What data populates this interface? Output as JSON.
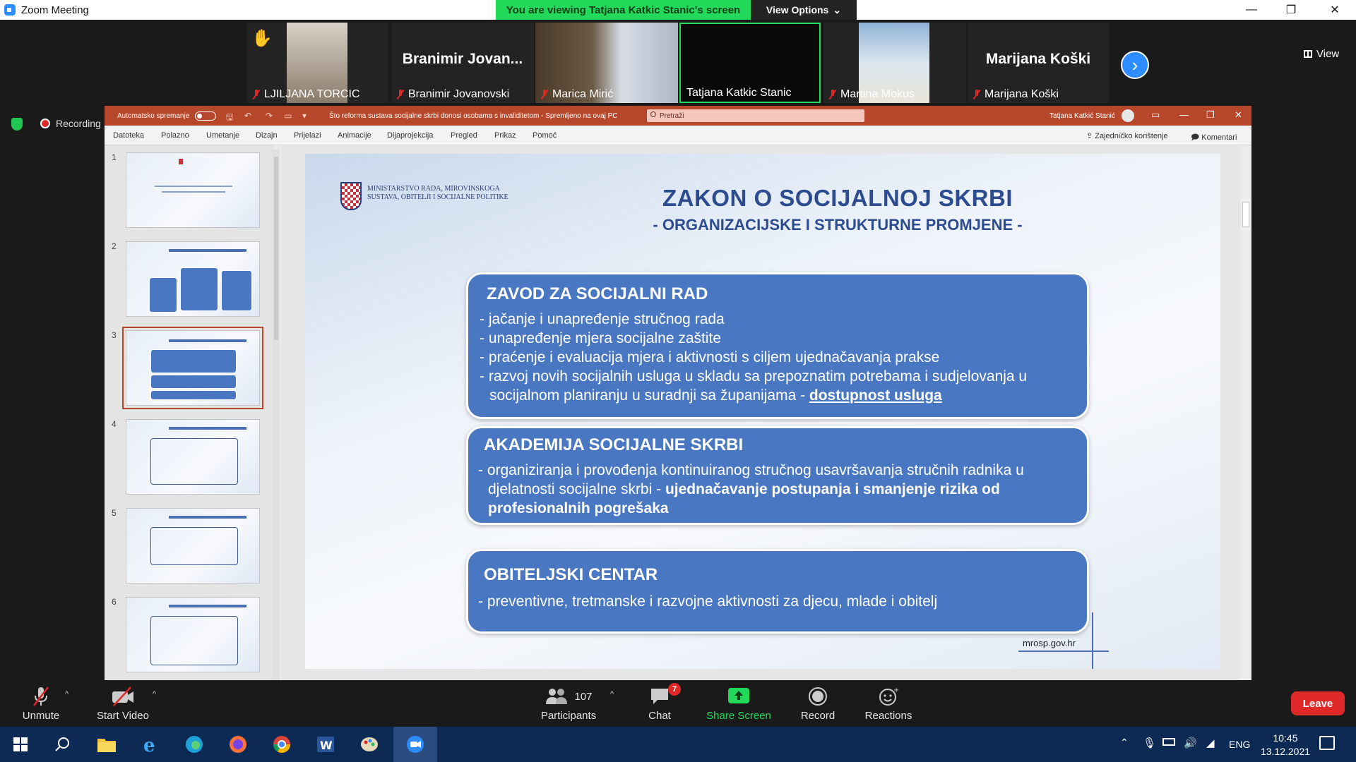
{
  "zoom": {
    "window_title": "Zoom Meeting",
    "viewing_banner": "You are viewing Tatjana Katkic Stanic's screen",
    "view_options": "View Options",
    "view_label": "View",
    "recording_label": "Recording"
  },
  "participants": [
    {
      "name": "LJILJANA TORCIC",
      "muted": true,
      "hand_raised": true
    },
    {
      "name": "Branimir Jovanovski",
      "display": "Branimir  Jovan...",
      "muted": true
    },
    {
      "name": "Marica Mirić",
      "muted": true
    },
    {
      "name": "Tatjana Katkic Stanic",
      "muted": false,
      "active_speaker": true
    },
    {
      "name": "Martina Mokus",
      "muted": true
    },
    {
      "name": "Marijana Koški",
      "display": "Marijana Koški",
      "muted": true
    }
  ],
  "ppt": {
    "autosave_label": "Automatsko spremanje",
    "doc_title": "Što reforma sustava socijalne skrbi donosi osobama s invaliditetom - Spremljeno na ovaj PC",
    "search_placeholder": "Pretraži",
    "user_name": "Tatjana Katkić Stanić",
    "tabs": [
      "Datoteka",
      "Polazno",
      "Umetanje",
      "Dizajn",
      "Prijelazi",
      "Animacije",
      "Dijaprojekcija",
      "Pregled",
      "Prikaz",
      "Pomoć"
    ],
    "share_label": "Zajedničko korištenje",
    "comments_label": "Komentari",
    "thumbnails": [
      "1",
      "2",
      "3",
      "4",
      "5",
      "6"
    ],
    "selected_slide": 3
  },
  "slide": {
    "ministry": [
      "MINISTARSTVO RADA, MIROVINSKOGA",
      "SUSTAVA, OBITELJI I SOCIJALNE POLITIKE"
    ],
    "title": "ZAKON O SOCIJALNOJ SKRBI",
    "subtitle": "- ORGANIZACIJSKE I STRUKTURNE PROMJENE -",
    "box1": {
      "header": "ZAVOD ZA SOCIJALNI RAD",
      "items": [
        "- jačanje i unapređenje stručnog rada",
        "- unapređenje mjera socijalne zaštite",
        "- praćenje i evaluacija mjera i aktivnosti  s ciljem ujednačavanja prakse",
        "- razvoj novih socijalnih usluga u skladu sa prepoznatim potrebama i sudjelovanja u"
      ],
      "item5_text": "socijalnom planiranju u suradnji sa županijama - ",
      "item5_emph": "dostupnost usluga"
    },
    "box2": {
      "header": "AKADEMIJA SOCIJALNE SKRBI",
      "line1": "- organiziranja i provođenja kontinuiranog stručnog usavršavanja stručnih radnika u",
      "line2_text": "djelatnosti socijalne skrbi - ",
      "line2_emph": "ujednačavanje postupanja i smanjenje rizika od",
      "line3_emph": "profesionalnih pogrešaka"
    },
    "box3": {
      "header": "OBITELJSKI CENTAR",
      "item": "- preventivne, tretmanske i razvojne aktivnosti za djecu, mlade i obitelj"
    },
    "url": "mrosp.gov.hr"
  },
  "toolbar": {
    "unmute": "Unmute",
    "start_video": "Start Video",
    "participants_label": "Participants",
    "participants_count": "107",
    "chat": "Chat",
    "chat_badge": "7",
    "share_screen": "Share Screen",
    "record": "Record",
    "reactions": "Reactions",
    "leave": "Leave"
  },
  "taskbar": {
    "language": "ENG",
    "time": "10:45",
    "date": "13.12.2021"
  },
  "colors": {
    "zoom_green": "#23d959",
    "ppt_red": "#b7472a",
    "slide_box_blue": "#4a77c2",
    "leave_red": "#e02828"
  }
}
